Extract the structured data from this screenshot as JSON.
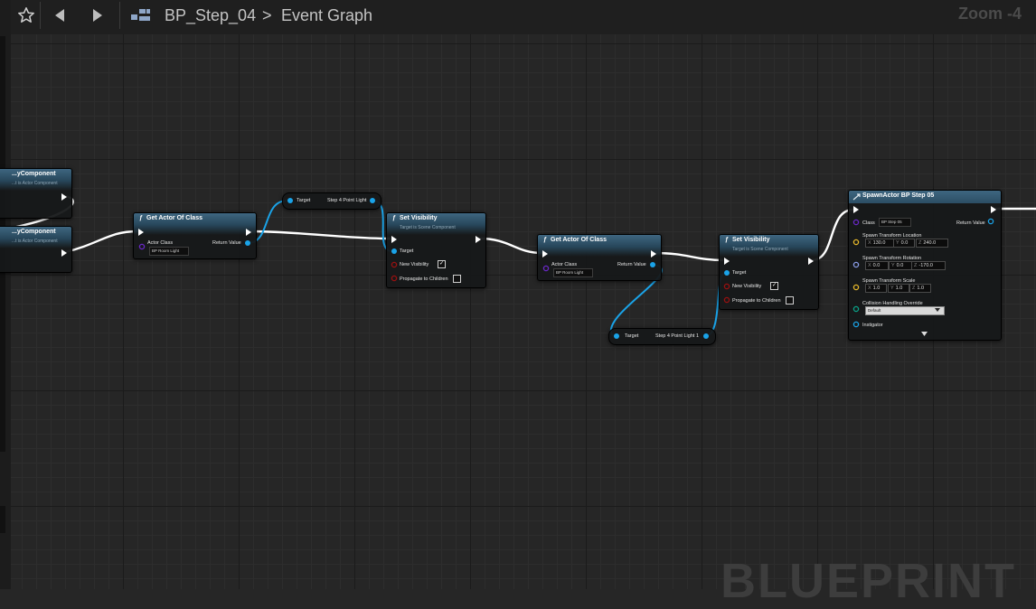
{
  "toolbar": {
    "favorite_icon": "star-icon",
    "back_icon": "arrow-left-icon",
    "forward_icon": "arrow-right-icon",
    "graph_icon": "blueprint-graph-icon",
    "breadcrumb_blueprint": "BP_Step_04",
    "breadcrumb_separator": ">",
    "breadcrumb_graph": "Event Graph",
    "zoom": "Zoom -4"
  },
  "watermark": "BLUEPRINT",
  "colors": {
    "exec_wire": "#ffffff",
    "object_pin": "#1aa3e8",
    "class_pin": "#6a28c8",
    "bool_pin": "#9a1010",
    "vector_pin": "#e8b92a",
    "rotator_pin": "#8a9de8",
    "byte_pin": "#0aa58a",
    "node_header": "#3e6680"
  },
  "nodes": {
    "partial_top": {
      "title": "...yComponent",
      "subtitle": "...t is Actor Component"
    },
    "partial_bottom": {
      "title": "...yComponent",
      "subtitle": "...t is Actor Component"
    },
    "get_actor_1": {
      "title": "Get Actor Of Class",
      "actor_class_label": "Actor Class",
      "actor_class_value": "BP Room Light",
      "return_label": "Return Value"
    },
    "var_point_light_1": {
      "target_label": "Target",
      "output_label": "Step 4 Point Light"
    },
    "set_visibility_1": {
      "title": "Set Visibility",
      "subtitle": "Target is Scene Component",
      "target_label": "Target",
      "new_visibility_label": "New Visibility",
      "new_visibility_checked": "✓",
      "propagate_label": "Propagate to Children",
      "propagate_checked": ""
    },
    "get_actor_2": {
      "title": "Get Actor Of Class",
      "actor_class_label": "Actor Class",
      "actor_class_value": "BP Room Light",
      "return_label": "Return Value"
    },
    "var_point_light_2": {
      "target_label": "Target",
      "output_label": "Step 4 Point Light 1"
    },
    "set_visibility_2": {
      "title": "Set Visibility",
      "subtitle": "Target is Scene Component",
      "target_label": "Target",
      "new_visibility_label": "New Visibility",
      "new_visibility_checked": "✓",
      "propagate_label": "Propagate to Children",
      "propagate_checked": ""
    },
    "spawn_actor": {
      "title": "SpawnActor BP Step 05",
      "class_label": "Class",
      "class_value": "BP Step 05",
      "return_label": "Return Value",
      "location_label": "Spawn Transform Location",
      "location": {
        "x": "130.0",
        "y": "0.0",
        "z": "240.0"
      },
      "rotation_label": "Spawn Transform Rotation",
      "rotation": {
        "x": "0.0",
        "y": "0.0",
        "z": "-170.0"
      },
      "scale_label": "Spawn Transform Scale",
      "scale": {
        "x": "1.0",
        "y": "1.0",
        "z": "1.0"
      },
      "collision_label": "Collision Handling Override",
      "collision_value": "Default",
      "instigator_label": "Instigator",
      "axis_x": "X",
      "axis_y": "Y",
      "axis_z": "Z"
    }
  }
}
